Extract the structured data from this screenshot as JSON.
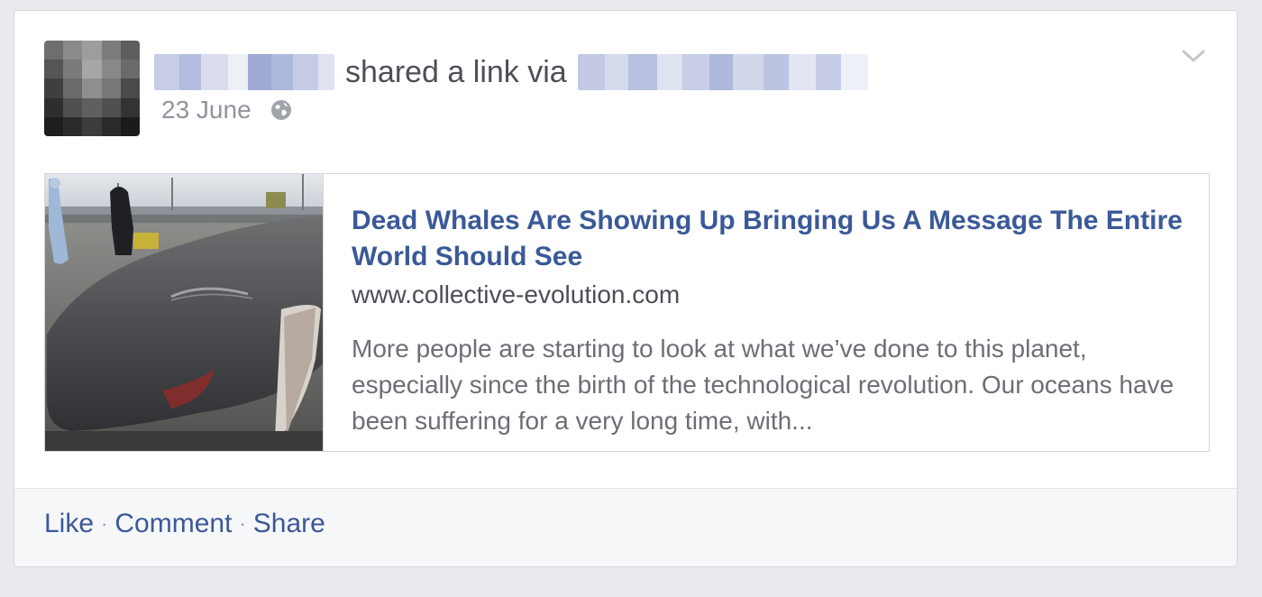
{
  "post": {
    "action_text": "shared a link via",
    "date": "23 June",
    "privacy_icon": "globe-icon",
    "menu_icon": "chevron-down-icon"
  },
  "link": {
    "title": "Dead Whales Are Showing Up Bringing Us A Message The Entire World Should See",
    "domain": "www.collective-evolution.com",
    "description": "More people are starting to look at what we’ve done to this planet, especially since the birth of the technological revolution. Our oceans have been suffering for a very long time, with..."
  },
  "footer": {
    "like": "Like",
    "comment": "Comment",
    "share": "Share",
    "separator": "·"
  },
  "colors": {
    "link_blue": "#3b5998",
    "text_gray": "#4b4f56",
    "meta_gray": "#90949c",
    "page_background": "#e9eaed"
  }
}
